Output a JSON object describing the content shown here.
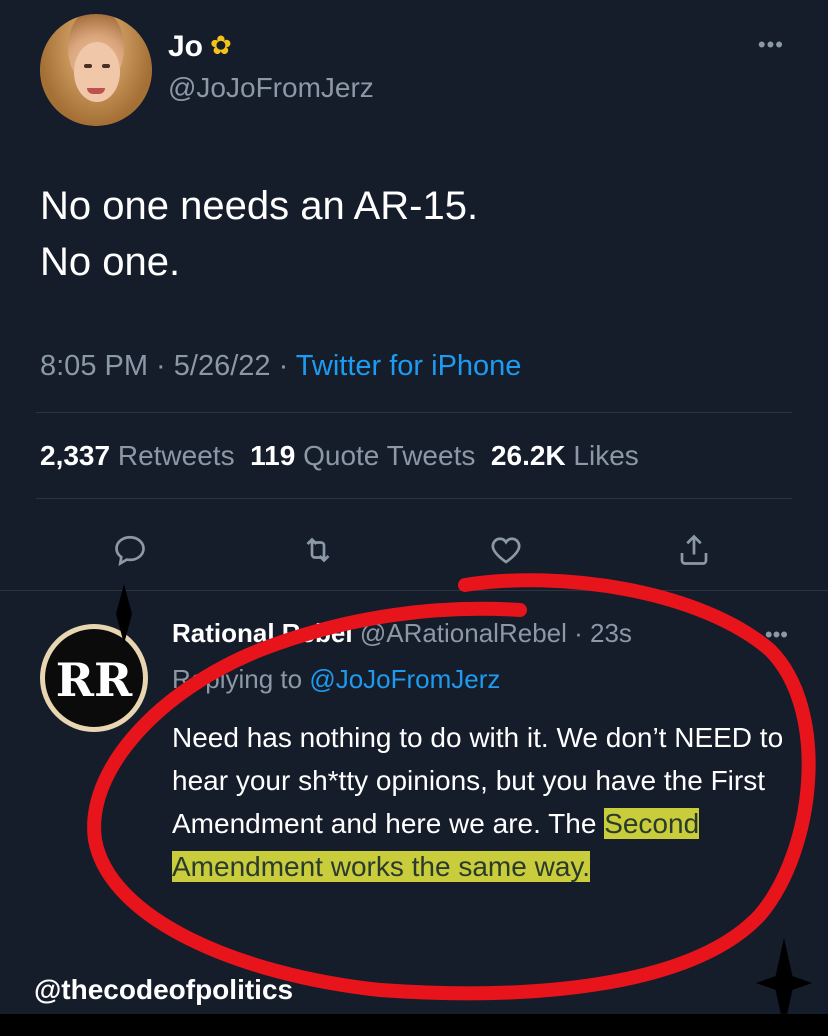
{
  "tweet": {
    "name": "Jo",
    "handle": "@JoJoFromJerz",
    "more": "•••",
    "line1": "No one needs an AR-15.",
    "line2": "No one.",
    "time": "8:05 PM · 5/26/22 · ",
    "source": "Twitter for iPhone",
    "stats": {
      "retweets_count": "2,337",
      "retweets_label": "Retweets",
      "quotes_count": "119",
      "quotes_label": "Quote Tweets",
      "likes_count": "26.2K",
      "likes_label": "Likes"
    },
    "actions": [
      "reply-icon",
      "retweet-icon",
      "like-icon",
      "share-icon"
    ]
  },
  "reply": {
    "name": "Rational Rebel",
    "handle_time": "@ARationalRebel · 23s",
    "more": "•••",
    "replying_prefix": "Replying to",
    "replying_to": "@JoJoFromJerz",
    "body_part1": "Need has nothing to do with it. We don’t NEED to hear your sh*tty opinions, but you have the First Amendment and here we are. The ",
    "body_highlight": "Second Amendment works the same way.",
    "logo_text": "RR"
  },
  "watermark": "@thecodeofpolitics",
  "colors": {
    "background": "#151c2a",
    "link": "#1d9bf0",
    "highlight": "#c9cc3b",
    "annotation_circle": "#e8141c"
  }
}
